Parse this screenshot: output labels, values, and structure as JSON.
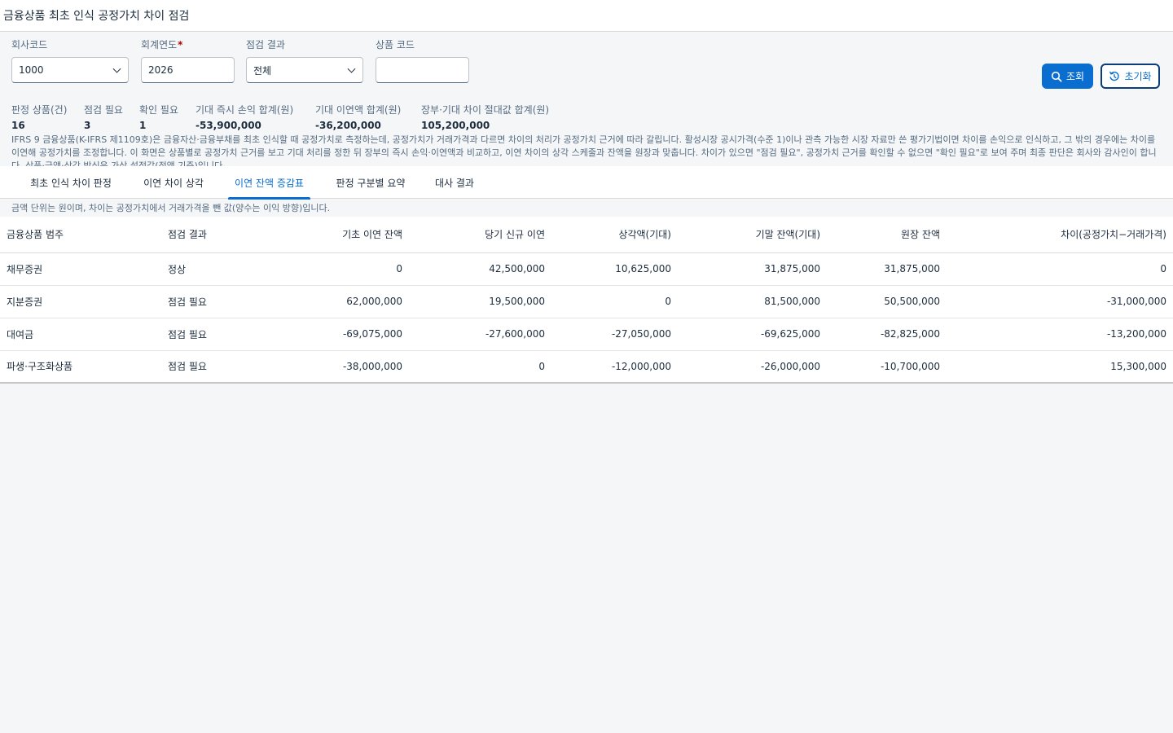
{
  "header": {
    "title": "금융상품 최초 인식 공정가치 차이 점검"
  },
  "filters": {
    "company_code": {
      "label": "회사코드",
      "value": "1000"
    },
    "fiscal_year": {
      "label": "회계연도",
      "required_mark": "*",
      "value": "2026"
    },
    "check_result": {
      "label": "점검 결과",
      "value": "전체"
    },
    "product_code": {
      "label": "상품 코드",
      "value": ""
    }
  },
  "actions": {
    "search_label": "조회",
    "reset_label": "초기화"
  },
  "kpis": [
    {
      "label": "판정 상품(건)",
      "value": "16"
    },
    {
      "label": "점검 필요",
      "value": "3"
    },
    {
      "label": "확인 필요",
      "value": "1"
    },
    {
      "label": "기대 즉시 손익 합계(원)",
      "value": "-53,900,000"
    },
    {
      "label": "기대 이연액 합계(원)",
      "value": "-36,200,000"
    },
    {
      "label": "장부·기대 차이 절대값 합계(원)",
      "value": "105,200,000"
    }
  ],
  "description": "IFRS 9 금융상품(K-IFRS 제1109호)은 금융자산·금융부채를 최초 인식할 때 공정가치로 측정하는데, 공정가치가 거래가격과 다르면 차이의 처리가 공정가치 근거에 따라 갈립니다. 활성시장 공시가격(수준 1)이나 관측 가능한 시장 자료만 쓴 평가기법이면 차이를 손익으로 인식하고, 그 밖의 경우에는 차이를 이연해 공정가치를 조정합니다. 이 화면은 상품별로 공정가치 근거를 보고 기대 처리를 정한 뒤 장부의 즉시 손익·이연액과 비교하고, 이연 차이의 상각 스케줄과 잔액을 원장과 맞춥니다. 차이가 있으면 \"점검 필요\", 공정가치 근거를 확인할 수 없으면 \"확인 필요\"로 보여 주며 최종 판단은 회사와 감사인이 합니다. 상품·금액·상각 방식은 가상 설정값(정액 기준)입니다.",
  "tabs": [
    {
      "label": "최초 인식 차이 판정"
    },
    {
      "label": "이연 차이 상각"
    },
    {
      "label": "이연 잔액 증감표"
    },
    {
      "label": "판정 구분별 요약"
    },
    {
      "label": "대사 결과"
    }
  ],
  "unit_note": "금액 단위는 원이며, 차이는 공정가치에서 거래가격을 뺀 값(양수는 이익 방향)입니다.",
  "table": {
    "columns": [
      "금융상품 범주",
      "점검 결과",
      "기초 이연 잔액",
      "당기 신규 이연",
      "상각액(기대)",
      "기말 잔액(기대)",
      "원장 잔액",
      "차이(공정가치−거래가격)"
    ],
    "rows": [
      {
        "category": "채무증권",
        "status": "정상",
        "opening": "0",
        "new": "42,500,000",
        "amort": "10,625,000",
        "closing": "31,875,000",
        "ledger": "31,875,000",
        "diff": "0"
      },
      {
        "category": "지분증권",
        "status": "점검 필요",
        "opening": "62,000,000",
        "new": "19,500,000",
        "amort": "0",
        "closing": "81,500,000",
        "ledger": "50,500,000",
        "diff": "-31,000,000"
      },
      {
        "category": "대여금",
        "status": "점검 필요",
        "opening": "-69,075,000",
        "new": "-27,600,000",
        "amort": "-27,050,000",
        "closing": "-69,625,000",
        "ledger": "-82,825,000",
        "diff": "-13,200,000"
      },
      {
        "category": "파생·구조화상품",
        "status": "점검 필요",
        "opening": "-38,000,000",
        "new": "0",
        "amort": "-12,000,000",
        "closing": "-26,000,000",
        "ledger": "-10,700,000",
        "diff": "15,300,000"
      }
    ]
  },
  "colors": {
    "accent": "#0a6ed1",
    "ok": "#256f3a",
    "warn": "#c35500"
  },
  "icons": {
    "search": "search-icon",
    "reset": "reset-icon",
    "dropdown": "chevron-down-icon"
  }
}
